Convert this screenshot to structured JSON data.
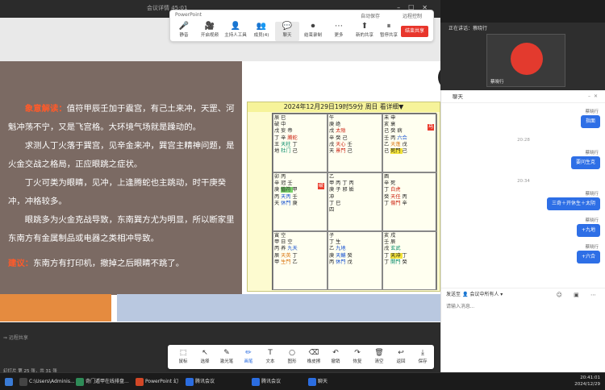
{
  "ppt": {
    "window_title": "会议详情  45:01",
    "status_left": "PowerPoint",
    "status_recording": "自动保存",
    "status_remote": "远程控制",
    "bottom_status": "幻灯片 第 25 张，共 31 张",
    "cursor_label": "⇒ 远程共享"
  },
  "meeting_toolbar": {
    "items": [
      {
        "label": "静音",
        "icon": "🎤"
      },
      {
        "label": "开启视频",
        "icon": "🎥"
      },
      {
        "label": "主持人工具",
        "icon": "👤"
      },
      {
        "label": "成员(4)",
        "icon": "👥"
      },
      {
        "label": "聊天",
        "icon": "💬"
      },
      {
        "label": "结束录制",
        "icon": "⏺"
      },
      {
        "label": "更多",
        "icon": "⋯"
      },
      {
        "label": "新的共享",
        "icon": "⬆"
      },
      {
        "label": "暂停共享",
        "icon": "⏸"
      }
    ],
    "end_share": "结束共享"
  },
  "slide": {
    "p1_label": "象意解读：",
    "p1_text": "值符甲辰壬加于震宫，有己土来冲，天罡、河魁冲荡不宁，又是飞宫格。大环境气场就是躁动的。",
    "p2": "求测人丁火落于巽宫，见辛金来冲，巽宫主精神问题，是火金交战之格局，正应眼跳之症状。",
    "p3": "丁火可类为眼睛，见冲，上逢腾蛇也主跳动，时干庚癸冲，冲格较多。",
    "p4": "眼跳多为火金克战导致，东南巽方尤为明显，所以断家里东南方有金属制品或电器之类相冲导致。",
    "p5_label": "建议：",
    "p5_text": "东南方有打印机，撤掉之后眼睛不跳了。"
  },
  "chart": {
    "header": "2024年12月29日19时59分 周日 看详细▼",
    "cells": [
      {
        "lines": [
          "辰 巳",
          "破 中",
          "戊 妄 帝",
          "丁 辛 腾蛇",
          "王 天柱 丁",
          "地 杜门 己"
        ],
        "tag": "",
        "hl": ""
      },
      {
        "lines": [
          "午",
          "庚 绝",
          "戊 太陰",
          "辛 癸 己",
          "戊 天心 壬",
          "天 景門 己"
        ],
        "tag": "",
        "hl": ""
      },
      {
        "lines": [
          "未 申",
          "亥 衰",
          "己 癸 病",
          "壬 丙 六合",
          "乙 天蓬 戊",
          "己 死門 己"
        ],
        "tag": "马",
        "hl": "死門"
      },
      {
        "lines": [
          "卯 丙",
          "辛 冠 壬",
          "庚 值符 甲",
          "丙 天丙 壬",
          "天 休門 庚"
        ],
        "tag": "破",
        "hl": "值符"
      },
      {
        "lines": [
          "乙",
          "甲 丙 丁 丙",
          "庚 子 邪 姤",
          "冲",
          "丁 巳",
          "四"
        ],
        "tag": "",
        "hl": ""
      },
      {
        "lines": [
          "酉",
          "辛 死",
          "丁 白虎",
          "癸 天任 丙",
          "丁 傷門 辛"
        ],
        "tag": "",
        "hl": ""
      },
      {
        "lines": [
          "寅 空",
          "甲 日 空",
          "丙 养 九天",
          "辰 天英 丁",
          "甲 生門 乙"
        ],
        "tag": "",
        "hl": ""
      },
      {
        "lines": [
          "子",
          "丁 生",
          "乙 九地",
          "庚 天輔 癸",
          "丙 休門 戊"
        ],
        "tag": "",
        "hl": ""
      },
      {
        "lines": [
          "亥 戌",
          "壬 辰",
          "戊 玄武",
          "丁 天冲 丁",
          "丁 開門 癸"
        ],
        "tag": "",
        "hl": "天冲"
      }
    ]
  },
  "video": {
    "speaking": "正在讲话：蔡晓行",
    "name": "蔡晓行"
  },
  "chat": {
    "title": "聊天",
    "messages": [
      {
        "sender": "蔡晓行",
        "text": "指面"
      },
      {
        "time": "20:28"
      },
      {
        "sender": "蔡晓行",
        "text": "要问生克"
      },
      {
        "time": "20:34"
      },
      {
        "sender": "蔡晓行",
        "text": "三奇＋开休生＋太阴"
      },
      {
        "sender": "蔡晓行",
        "text": "+九地"
      },
      {
        "sender": "蔡晓行",
        "text": "+六合"
      }
    ],
    "send_to_label": "发送至",
    "send_to_value": "会议中所有人",
    "input_placeholder": "请输入消息..."
  },
  "annot_toolbar": {
    "items": [
      "鼠标",
      "选择",
      "激光笔",
      "画笔",
      "文本",
      "图形",
      "橡皮擦",
      "撤销",
      "恢复",
      "清空",
      "返回",
      "保存"
    ]
  },
  "taskbar": {
    "items": [
      "C:\\Users\\Adminis...",
      "奇门遁甲在线排盘...",
      "PowerPoint 幻灯片",
      "腾讯会议",
      "腾讯会议",
      "聊天"
    ],
    "time": "20:41:01",
    "date": "2024/12/29"
  },
  "colors": {
    "slide_brown": "#7b6a63",
    "highlight_orange": "#ff5a2a",
    "end_share_red": "#e8352b",
    "chat_blue": "#2e6fe6",
    "chart_yellow": "#fdfbd0"
  }
}
